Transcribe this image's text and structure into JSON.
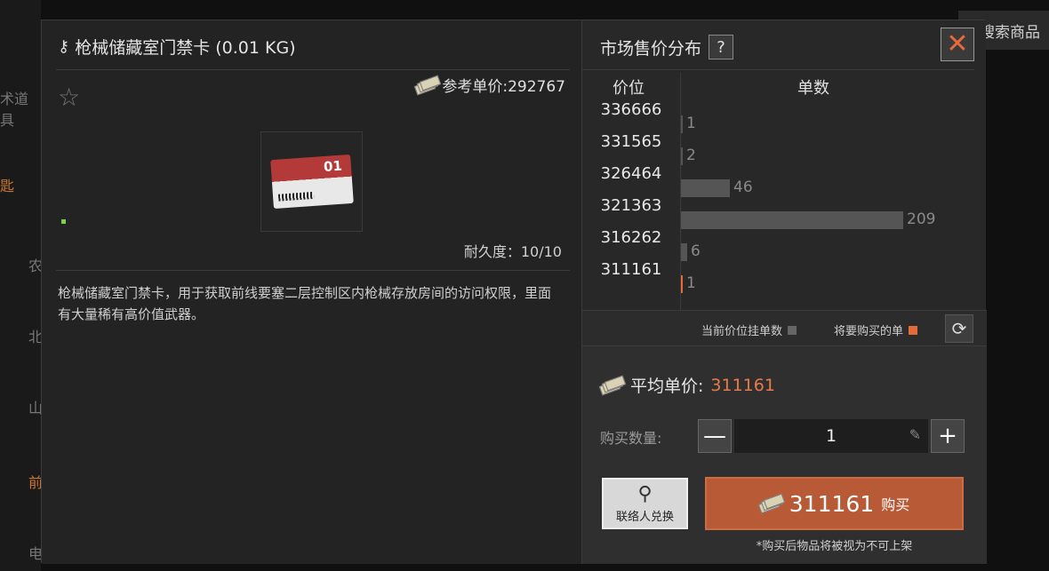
{
  "background": {
    "top_right_label": "搜索商品",
    "left_items": [
      "术道具",
      "匙",
      "农",
      "北",
      "山",
      "前",
      "电"
    ]
  },
  "item": {
    "title": "枪械储藏室门禁卡 (0.01 KG)",
    "ref_price_label": "参考单价:292767",
    "card_number": "01",
    "durability": "耐久度：10/10",
    "description": "枪械储藏室门禁卡，用于获取前线要塞二层控制区内枪械存放房间的访问权限，里面有大量稀有高价值武器。"
  },
  "market": {
    "title": "市场售价分布",
    "help_label": "?",
    "close_label": "✕",
    "col_price": "价位",
    "col_count": "单数",
    "legend_current": "当前价位挂单数",
    "legend_buy": "将要购买的单",
    "colors": {
      "current": "#555555",
      "buy": "#e46a3a",
      "accent": "#e87a4a"
    }
  },
  "chart_data": {
    "type": "bar",
    "orientation": "horizontal",
    "categories": [
      "336666",
      "331565",
      "326464",
      "321363",
      "316262",
      "311161"
    ],
    "values": [
      1,
      2,
      46,
      209,
      6,
      1
    ],
    "highlight_category": "311161",
    "xlabel": "单数",
    "ylabel": "价位"
  },
  "buy": {
    "avg_label": "平均单价:",
    "avg_value": "311161",
    "qty_label": "购买数量:",
    "qty_value": "1",
    "minus_label": "—",
    "plus_label": "+",
    "contact_label": "联络人兑换",
    "buy_price": "311161",
    "buy_label": "购买",
    "note": "*购买后物品将被视为不可上架"
  }
}
